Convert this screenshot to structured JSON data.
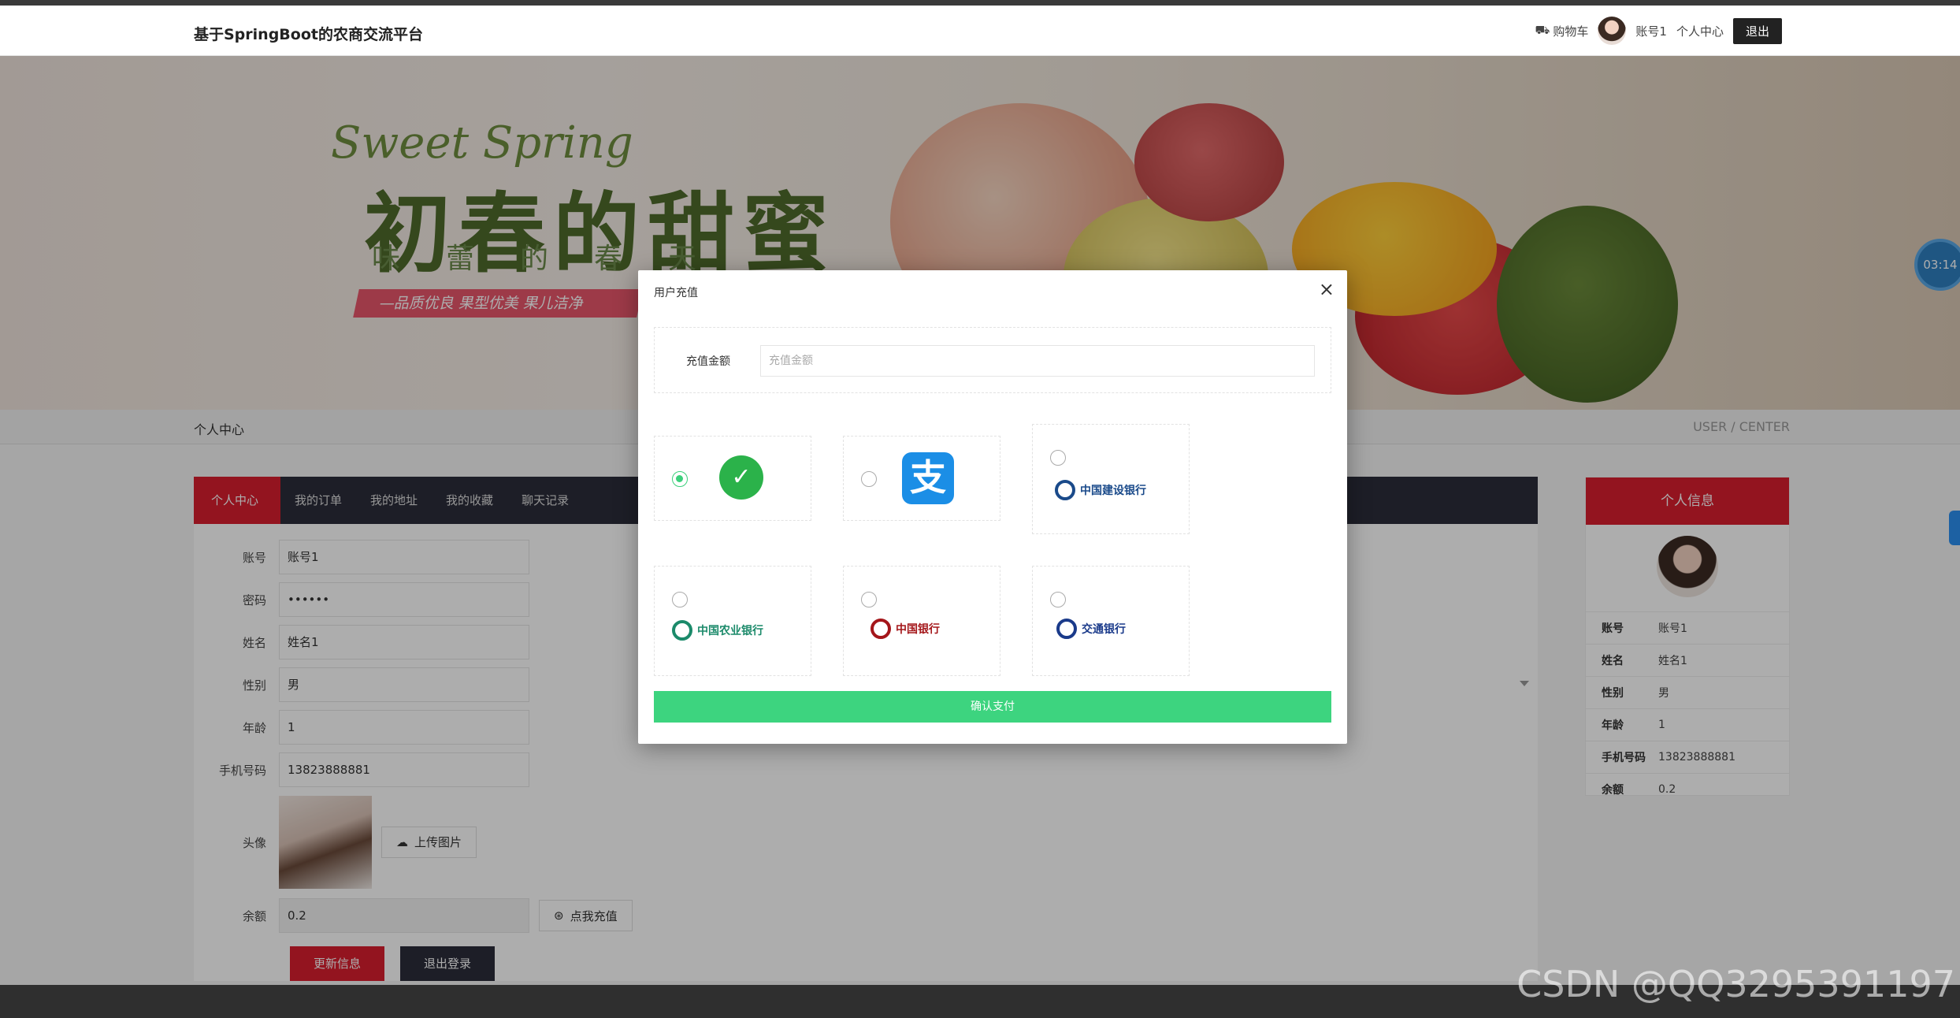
{
  "header": {
    "site_title": "基于SpringBoot的农商交流平台",
    "cart_label": "购物车",
    "username": "账号1",
    "user_center_label": "个人中心",
    "logout_label": "退出"
  },
  "banner": {
    "script_text": "Sweet Spring",
    "main_text": "初春的甜蜜",
    "sub_text": "味蕾的春天",
    "ribbon_text": "—品质优良 果型优美 果儿洁净"
  },
  "timer": {
    "value": "03:14"
  },
  "breadcrumb": {
    "left": "个人中心",
    "right": "USER / CENTER"
  },
  "tabs": [
    {
      "label": "个人中心",
      "active": true
    },
    {
      "label": "我的订单",
      "active": false
    },
    {
      "label": "我的地址",
      "active": false
    },
    {
      "label": "我的收藏",
      "active": false
    },
    {
      "label": "聊天记录",
      "active": false
    }
  ],
  "form": {
    "account_label": "账号",
    "account_value": "账号1",
    "password_label": "密码",
    "password_value": "••••••",
    "name_label": "姓名",
    "name_value": "姓名1",
    "gender_label": "性别",
    "gender_value": "男",
    "age_label": "年龄",
    "age_value": "1",
    "phone_label": "手机号码",
    "phone_value": "13823888881",
    "avatar_label": "头像",
    "upload_label": "上传图片",
    "balance_label": "余额",
    "balance_value": "0.2",
    "recharge_label": "点我充值",
    "update_btn": "更新信息",
    "logout_btn": "退出登录"
  },
  "side": {
    "title": "个人信息",
    "rows": [
      {
        "k": "账号",
        "v": "账号1"
      },
      {
        "k": "姓名",
        "v": "姓名1"
      },
      {
        "k": "性别",
        "v": "男"
      },
      {
        "k": "年龄",
        "v": "1"
      },
      {
        "k": "手机号码",
        "v": "13823888881"
      },
      {
        "k": "余额",
        "v": "0.2"
      }
    ]
  },
  "modal": {
    "title": "用户充值",
    "close": "×",
    "amount_label": "充值金额",
    "amount_placeholder": "充值金额",
    "wechat_glyph": "✓",
    "alipay_glyph": "支",
    "ccb_name": "中国建设银行",
    "abc_name": "中国农业银行",
    "boc_name": "中国银行",
    "bocom_name": "交通银行",
    "confirm": "确认支付"
  },
  "colors": {
    "accent_red": "#d91e2f",
    "dark_nav": "#2b2d3a",
    "pay_green": "#3dd47f"
  },
  "watermark": "CSDN @QQ3295391197"
}
